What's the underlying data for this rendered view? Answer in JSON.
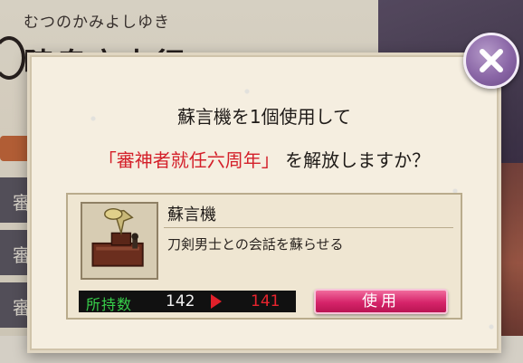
{
  "background": {
    "name_kana": "むつのかみよしゆき",
    "name_kanji": "陸奥守吉行",
    "side_tabs": [
      "審",
      "審",
      "審"
    ]
  },
  "dialog": {
    "message_line1": "蘇言機を1個使用して",
    "message_highlight": "「審神者就任六周年」",
    "message_line2_suffix": "を解放しますか？",
    "item": {
      "name": "蘇言機",
      "description": "刀剣男士との会話を蘇らせる",
      "icon": "phonograph-icon"
    },
    "count": {
      "label": "所持数",
      "current": "142",
      "after": "141"
    },
    "use_button_label": "使用",
    "close_icon": "close-icon"
  },
  "colors": {
    "highlight": "#d4202a",
    "count_label": "#37d04a",
    "count_after": "#e8242e",
    "use_button": "#d6246a",
    "close_button": "#8a66a6"
  }
}
